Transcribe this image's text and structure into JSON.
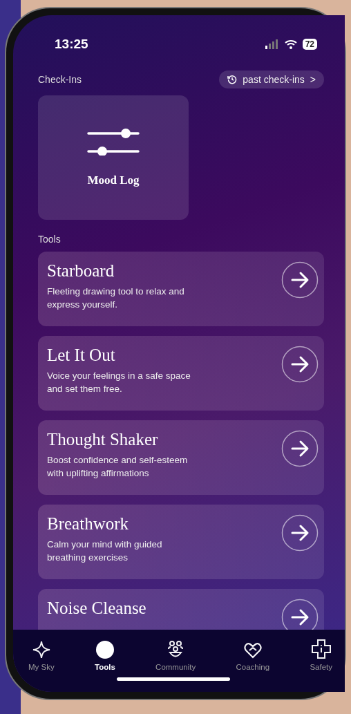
{
  "status_bar": {
    "time": "13:25",
    "battery": "72"
  },
  "check_ins": {
    "heading": "Check-Ins",
    "past_button": "past check-ins",
    "past_chevron": ">",
    "cards": [
      {
        "title": "Mood Log"
      }
    ]
  },
  "tools": {
    "heading": "Tools",
    "items": [
      {
        "title": "Starboard",
        "description": "Fleeting drawing tool to relax and express yourself."
      },
      {
        "title": "Let It Out",
        "description": "Voice your feelings in a safe space and set them free."
      },
      {
        "title": "Thought Shaker",
        "description": "Boost confidence and self-esteem with uplifting affirmations"
      },
      {
        "title": "Breathwork",
        "description": "Calm your mind with guided breathing exercises"
      },
      {
        "title": "Noise Cleanse"
      }
    ]
  },
  "tab_bar": [
    {
      "label": "My Sky",
      "selected": false
    },
    {
      "label": "Tools",
      "selected": true
    },
    {
      "label": "Community",
      "selected": false
    },
    {
      "label": "Coaching",
      "selected": false
    },
    {
      "label": "Safety",
      "selected": false
    }
  ]
}
